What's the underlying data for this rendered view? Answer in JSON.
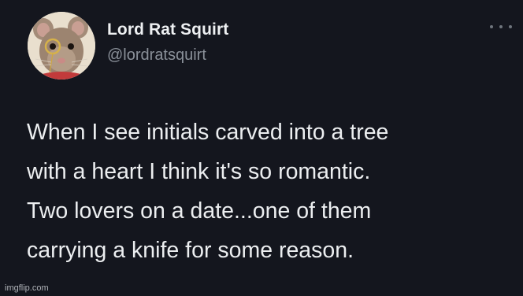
{
  "author": {
    "display_name": "Lord Rat Squirt",
    "handle": "@lordratsquirt",
    "avatar_icon": "rat-with-monocle-avatar"
  },
  "tweet": {
    "lines": [
      "When I see initials carved into a tree",
      "with a heart I think it's so romantic.",
      "Two lovers on a date...one of them",
      "carrying a knife for some reason."
    ]
  },
  "menu": {
    "icon": "more-options-icon"
  },
  "watermark": "imgflip.com",
  "colors": {
    "background": "#14161e",
    "text": "#eceef0",
    "handle": "#8a9099"
  }
}
